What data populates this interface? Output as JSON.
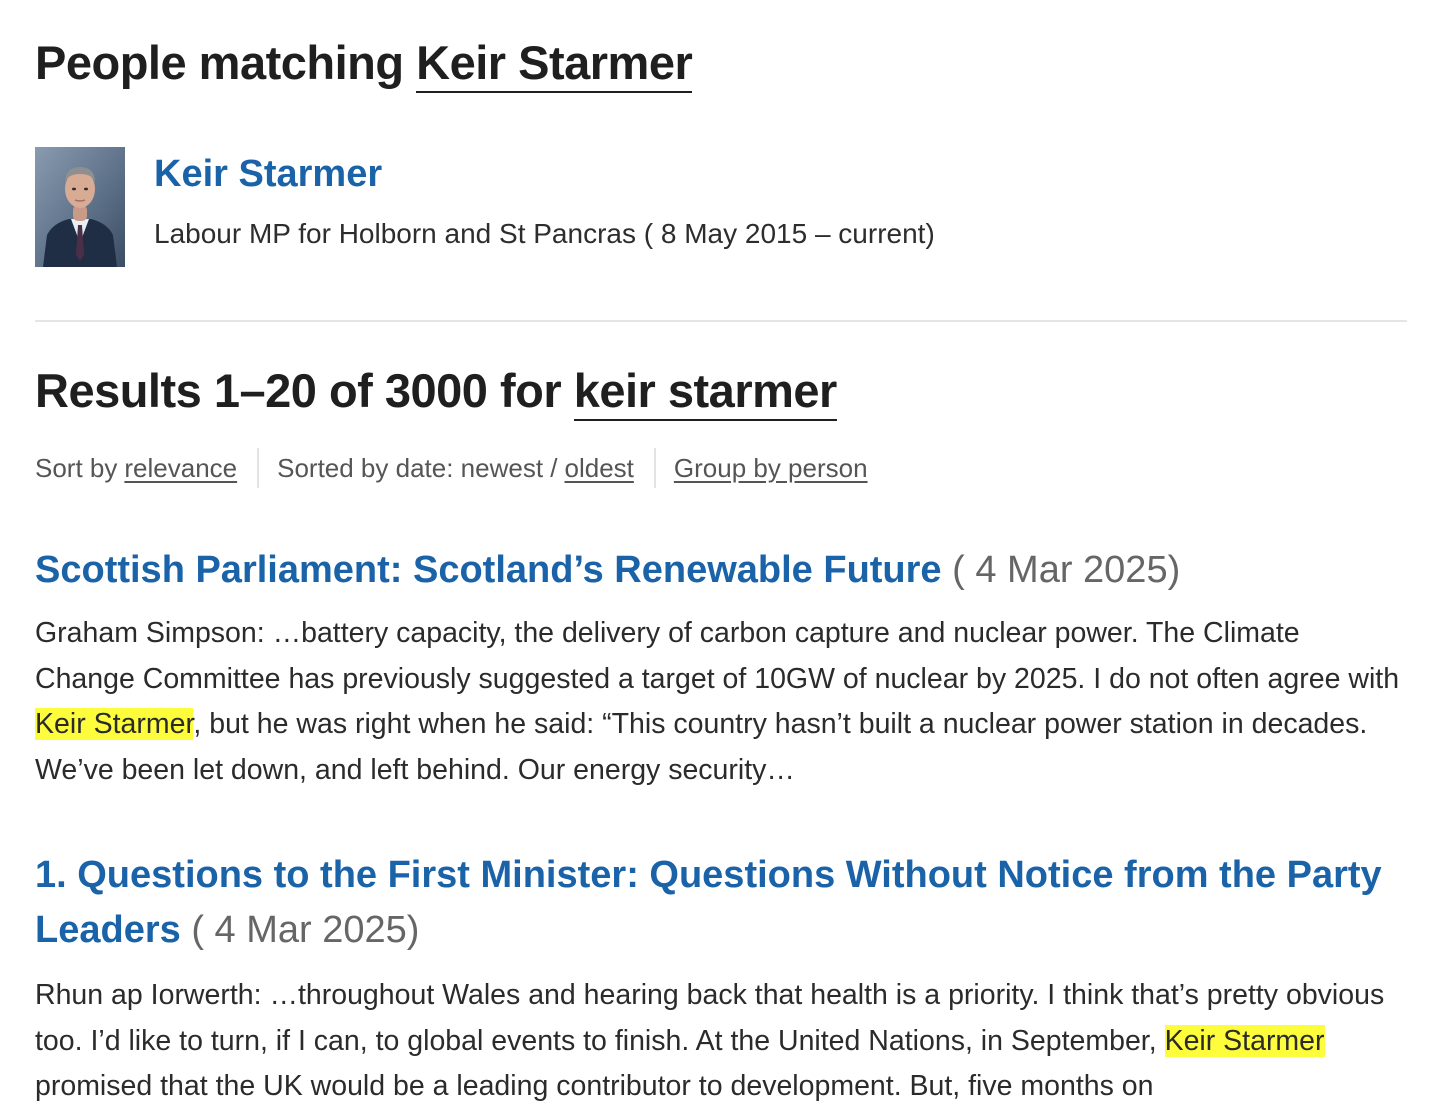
{
  "people_heading": {
    "prefix": "People matching",
    "query": "Keir Starmer"
  },
  "person": {
    "name": "Keir Starmer",
    "detail": "Labour MP for Holborn and St Pancras ( 8 May 2015 – current)",
    "photo_icon": "person-photo"
  },
  "results_heading": {
    "prefix": "Results 1–20 of 3000 for",
    "query": "keir starmer"
  },
  "sort": {
    "sort_by_label": "Sort by",
    "relevance_link": "relevance",
    "sorted_by_date_label": "Sorted by date: newest /",
    "oldest_link": "oldest",
    "group_by_person_link": "Group by person"
  },
  "results": [
    {
      "title": "Scottish Parliament: Scotland’s Renewable Future",
      "date": "( 4 Mar 2025)",
      "excerpt_before": "Graham Simpson: …battery capacity, the delivery of carbon capture and nuclear power. The Climate Change Committee has previously suggested a target of 10GW of nuclear by 2025. I do not often agree with ",
      "excerpt_highlight": "Keir Starmer",
      "excerpt_after": ", but he was right when he said: “This country hasn’t built a nuclear power station in decades. We’ve been let down, and left behind. Our energy security…"
    },
    {
      "title": "1. Questions to the First Minister: Questions Without Notice from the Party Leaders",
      "date": "( 4 Mar 2025)",
      "excerpt_before": "Rhun ap Iorwerth: …throughout Wales and hearing back that health is a priority. I think that’s pretty obvious too. I’d like to turn, if I can, to global events to finish. At the United Nations, in September, ",
      "excerpt_highlight": "Keir Starmer",
      "excerpt_after": " promised that the UK would be a leading contributor to development. But, five months on"
    }
  ],
  "colors": {
    "link_blue": "#1a63a8",
    "highlight_yellow": "#fdfd3c",
    "divider_gray": "#e5e5e5"
  }
}
